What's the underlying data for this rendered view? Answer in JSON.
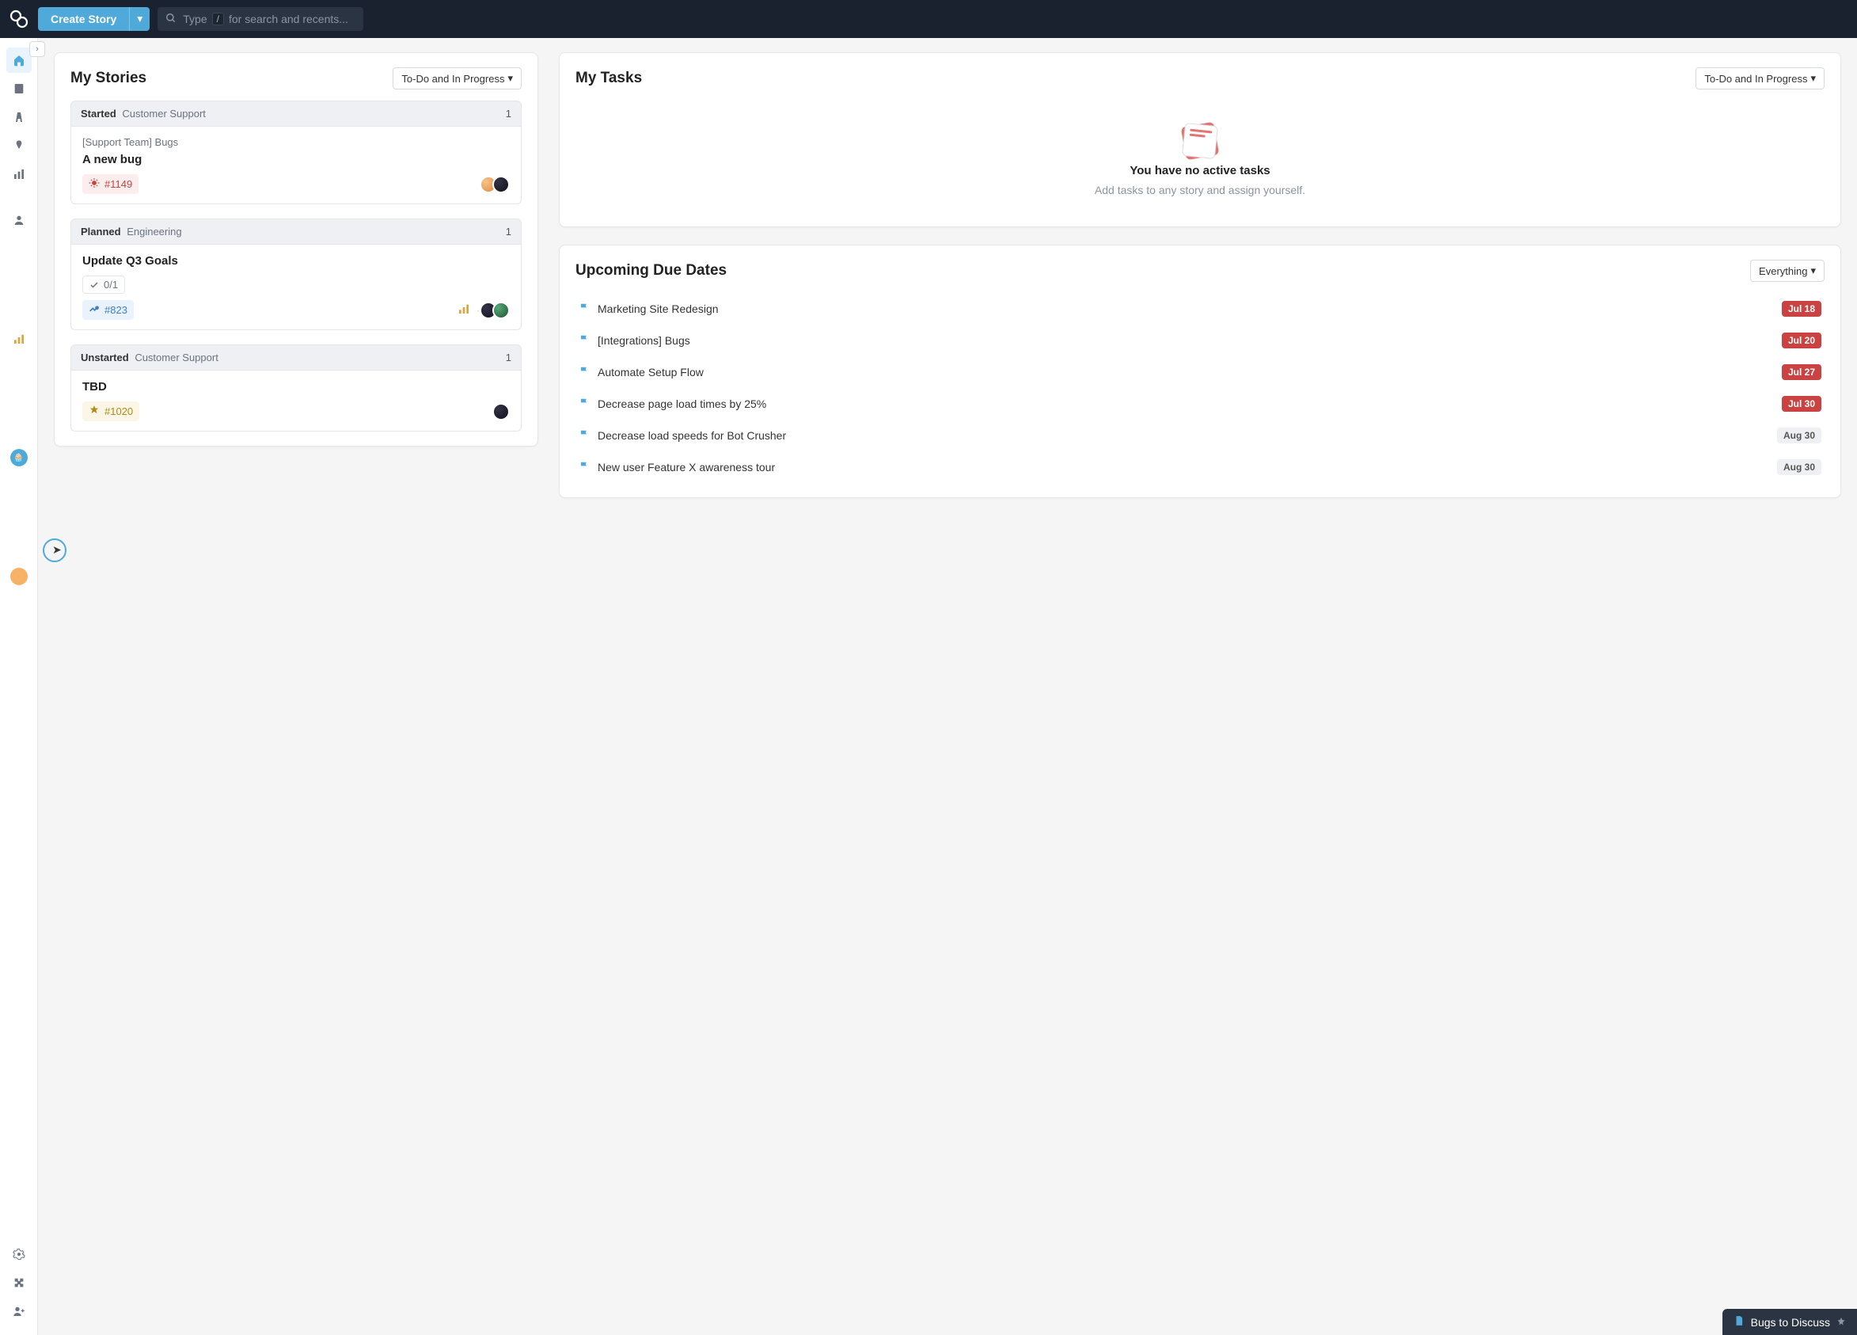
{
  "topbar": {
    "create_label": "Create Story",
    "search_prefix": "Type",
    "search_key": "/",
    "search_suffix": "for search and recents..."
  },
  "my_stories": {
    "title": "My Stories",
    "filter": "To-Do and In Progress",
    "groups": [
      {
        "state": "Started",
        "workflow": "Customer Support",
        "count": "1",
        "card": {
          "subtitle": "[Support Team] Bugs",
          "title": "A new bug",
          "badge_type": "bug",
          "badge_id": "#1149",
          "has_tasks": false,
          "owners": [
            "a1",
            "a2"
          ]
        }
      },
      {
        "state": "Planned",
        "workflow": "Engineering",
        "count": "1",
        "card": {
          "subtitle": "",
          "title": "Update Q3 Goals",
          "badge_type": "chore",
          "badge_id": "#823",
          "has_tasks": true,
          "task_count": "0/1",
          "show_bars": true,
          "owners": [
            "a2",
            "a3"
          ]
        }
      },
      {
        "state": "Unstarted",
        "workflow": "Customer Support",
        "count": "1",
        "card": {
          "subtitle": "",
          "title": "TBD",
          "badge_type": "feature",
          "badge_id": "#1020",
          "has_tasks": false,
          "owners": [
            "a2"
          ]
        }
      }
    ]
  },
  "my_tasks": {
    "title": "My Tasks",
    "filter": "To-Do and In Progress",
    "empty_title": "You have no active tasks",
    "empty_sub": "Add tasks to any story and assign yourself."
  },
  "due_dates": {
    "title": "Upcoming Due Dates",
    "filter": "Everything",
    "items": [
      {
        "title": "Marketing Site Redesign",
        "date": "Jul 18",
        "overdue": true
      },
      {
        "title": "[Integrations] Bugs",
        "date": "Jul 20",
        "overdue": true
      },
      {
        "title": "Automate Setup Flow",
        "date": "Jul 27",
        "overdue": true
      },
      {
        "title": "Decrease page load times by 25%",
        "date": "Jul 30",
        "overdue": true
      },
      {
        "title": "Decrease load speeds for Bot Crusher",
        "date": "Aug 30",
        "overdue": false
      },
      {
        "title": "New user Feature X awareness tour",
        "date": "Aug 30",
        "overdue": false
      }
    ]
  },
  "pinned": {
    "label": "Bugs to Discuss"
  }
}
